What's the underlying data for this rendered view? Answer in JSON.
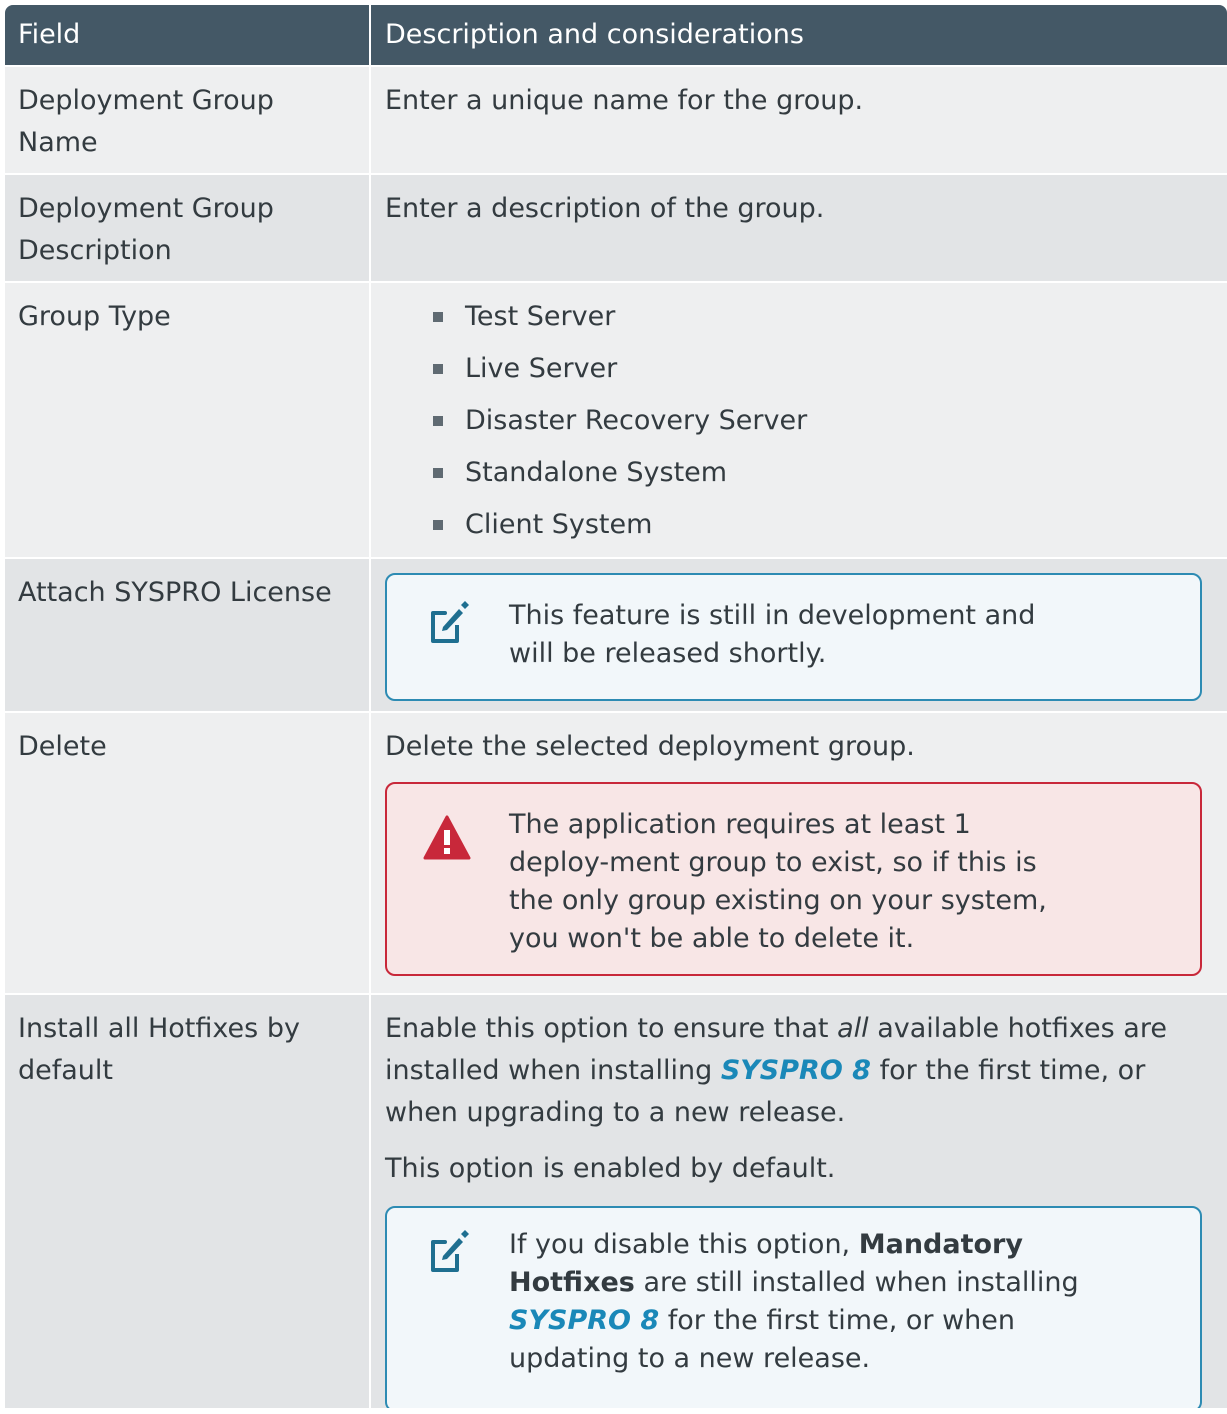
{
  "header": {
    "field": "Field",
    "description": "Description and considerations"
  },
  "rows": {
    "name": {
      "field": "Deployment Group Name",
      "desc": "Enter a unique name for the group."
    },
    "description": {
      "field": "Deployment Group Description",
      "desc": "Enter a description of the group."
    },
    "group_type": {
      "field": "Group Type",
      "options": [
        "Test Server",
        "Live Server",
        "Disaster Recovery Server",
        "Standalone System",
        "Client System"
      ]
    },
    "license": {
      "field": "Attach SYSPRO License",
      "note": "This feature is still in development and will be released shortly."
    },
    "delete": {
      "field": "Delete",
      "desc": "Delete the selected deployment group.",
      "warning": "The application requires at least 1 deploy-ment group to exist, so if this is the only group existing on your system, you won't be able to delete it."
    },
    "hotfixes": {
      "field": "Install all Hotfixes by default",
      "p1_a": "Enable this option to ensure that ",
      "p1_em": "all",
      "p1_b": " available hotfixes are installed when installing ",
      "p1_brand": "SYSPRO 8",
      "p1_c": " for the first time, or when upgrading to a new release.",
      "p2": "This option is enabled by default.",
      "note_a": "If you disable this option, ",
      "note_bold": "Mandatory Hotfixes",
      "note_b": " are still installed when installing ",
      "note_brand": "SYSPRO 8",
      "note_c": " for the first time, or when updating to a new release."
    }
  },
  "icons": {
    "note": "note-pencil-icon",
    "warning": "warning-triangle-icon"
  },
  "colors": {
    "header_bg": "#445866",
    "brand": "#1a88b8",
    "note_border": "#2d8bb3",
    "warn_border": "#c8283a",
    "warn_bg": "#f8e6e6"
  }
}
